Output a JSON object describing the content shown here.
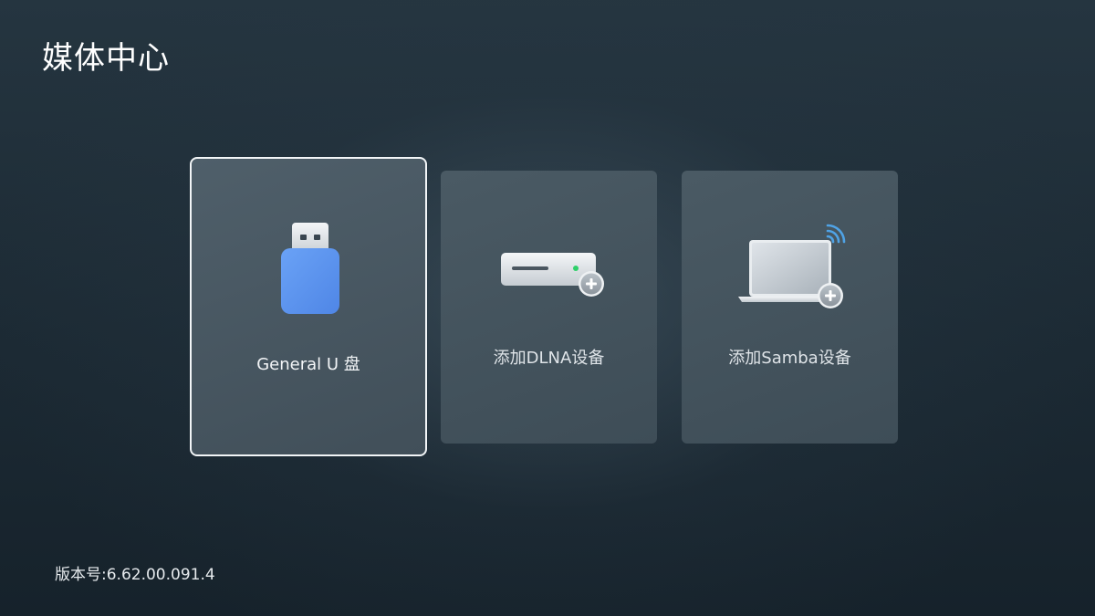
{
  "header": {
    "title": "媒体中心"
  },
  "tiles": [
    {
      "label": "General U 盘",
      "icon": "usb-drive-icon",
      "focused": true
    },
    {
      "label": "添加DLNA设备",
      "icon": "dlna-device-add-icon",
      "focused": false
    },
    {
      "label": "添加Samba设备",
      "icon": "samba-laptop-add-icon",
      "focused": false
    }
  ],
  "footer": {
    "version": "版本号:6.62.00.091.4"
  },
  "colors": {
    "usb_body": "#5b93f0",
    "wifi_signal": "#4fa3e6",
    "status_led": "#2fd06a",
    "focus_border": "#f2f5f7"
  }
}
